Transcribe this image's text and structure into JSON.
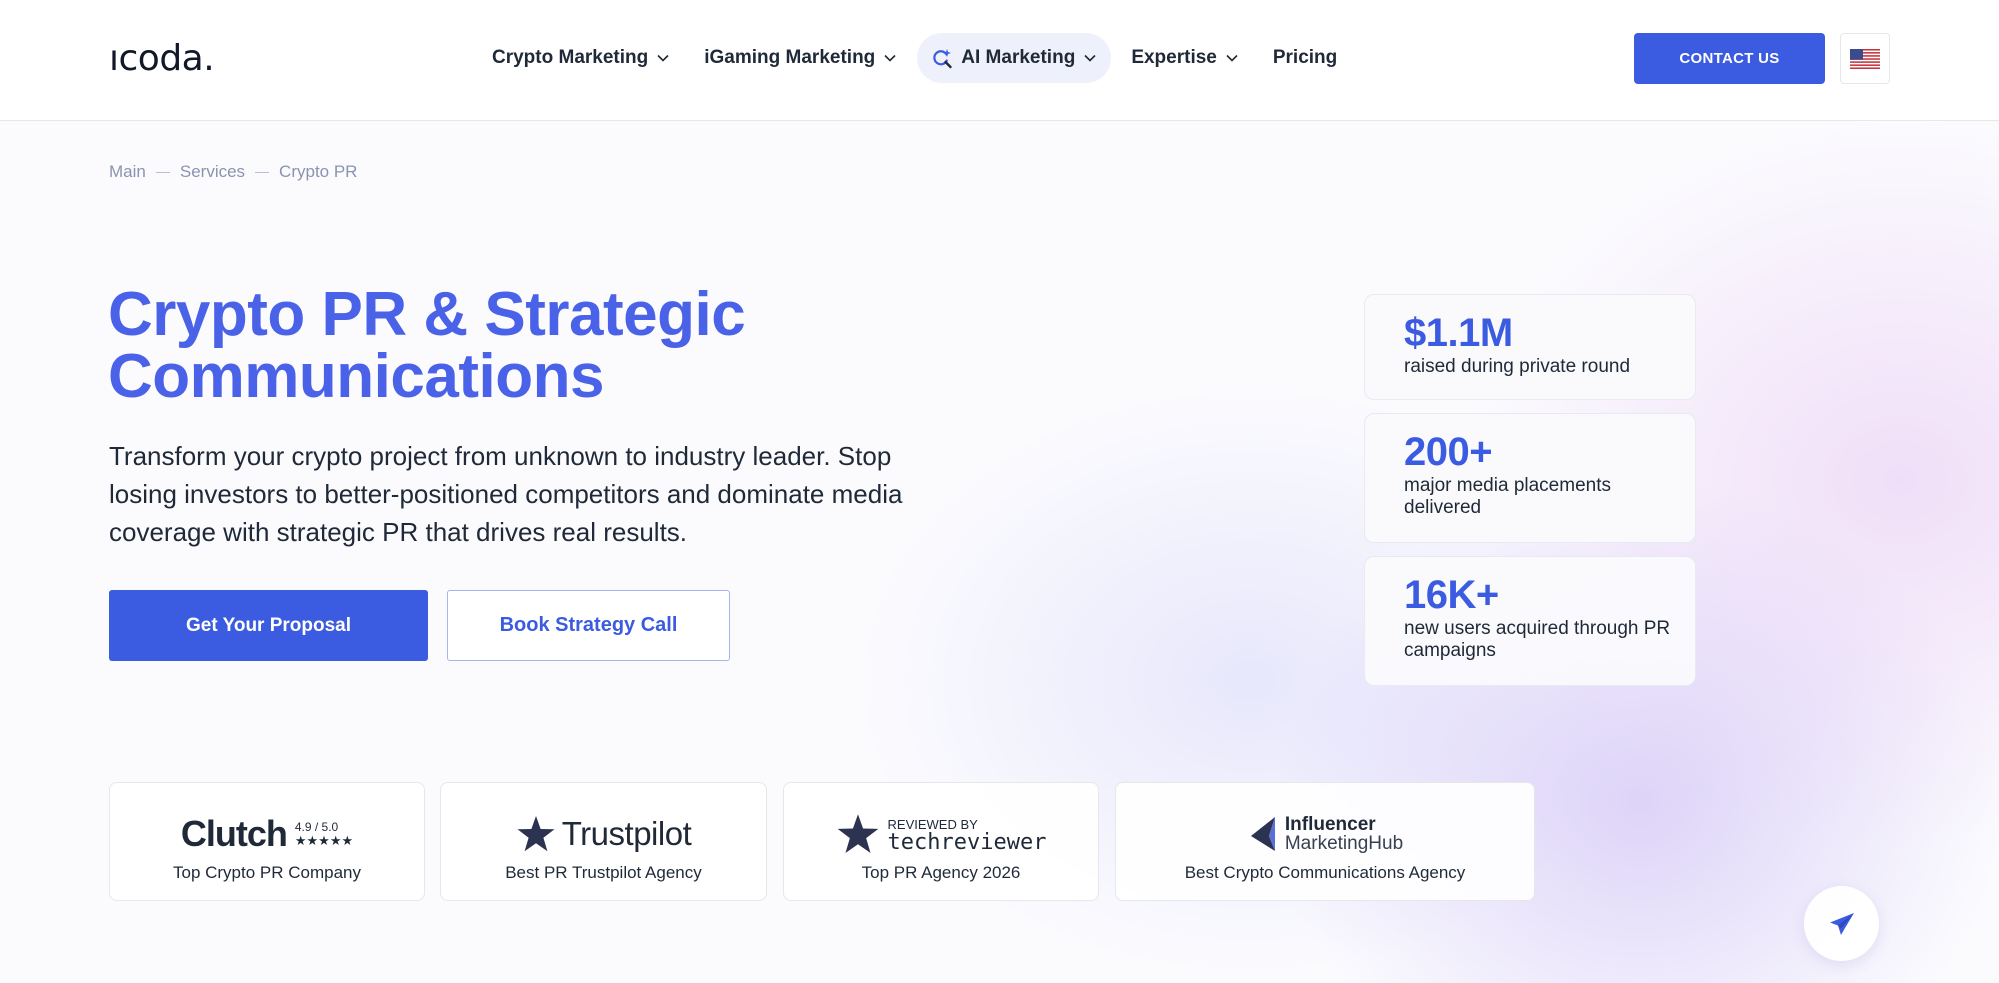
{
  "header": {
    "logo": "ıcoda.",
    "nav": [
      {
        "label": "Crypto Marketing",
        "has_dropdown": true
      },
      {
        "label": "iGaming Marketing",
        "has_dropdown": true
      },
      {
        "label": "AI Marketing",
        "has_dropdown": true,
        "active": true
      },
      {
        "label": "Expertise",
        "has_dropdown": true
      },
      {
        "label": "Pricing",
        "has_dropdown": false
      }
    ],
    "contact_label": "CONTACT US",
    "language_icon": "us-flag-icon"
  },
  "breadcrumb": [
    "Main",
    "Services",
    "Crypto PR"
  ],
  "hero": {
    "title_line1": "Crypto PR & Strategic",
    "title_line2": "Communications",
    "description": "Transform your crypto project from unknown to industry leader. Stop losing investors to better-positioned competitors and dominate media coverage with strategic PR that drives real results.",
    "primary_cta": "Get Your Proposal",
    "secondary_cta": "Book Strategy Call"
  },
  "stats": [
    {
      "value": "$1.1M",
      "label": "raised during private round"
    },
    {
      "value": "200+",
      "label": "major media placements delivered"
    },
    {
      "value": "16K+",
      "label": "new users acquired through PR campaigns"
    }
  ],
  "awards": [
    {
      "logo_text": "Clutch",
      "score": "4.9 / 5.0",
      "stars": "★★★★★",
      "caption": "Top Crypto PR Company"
    },
    {
      "logo_text": "Trustpilot",
      "caption": "Best PR Trustpilot Agency"
    },
    {
      "logo_top": "REVIEWED BY",
      "logo_text": "techreviewer",
      "caption": "Top PR Agency 2026"
    },
    {
      "logo_top": "Influencer",
      "logo_text": "MarketingHub",
      "caption": "Best Crypto Communications Agency"
    }
  ],
  "colors": {
    "accent": "#3b5be0",
    "title": "#4a62e8",
    "text": "#1f2937",
    "muted": "#8a94b0"
  }
}
